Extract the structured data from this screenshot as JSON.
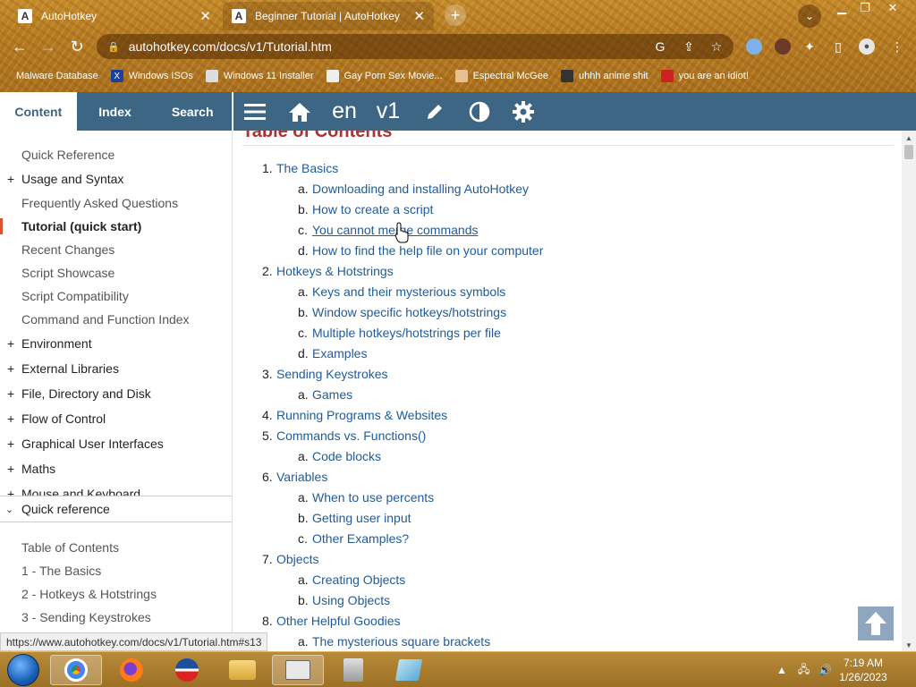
{
  "browser": {
    "tabs": [
      {
        "title": "AutoHotkey",
        "favicon": "A"
      },
      {
        "title": "Beginner Tutorial | AutoHotkey",
        "favicon": "A"
      }
    ],
    "url": "autohotkey.com/docs/v1/Tutorial.htm",
    "bookmarks": [
      {
        "label": "Malware Database"
      },
      {
        "label": "Windows ISOs"
      },
      {
        "label": "Windows 11 Installer"
      },
      {
        "label": "Gay Porn Sex Movie..."
      },
      {
        "label": "Espectral McGee"
      },
      {
        "label": "uhhh anime shit"
      },
      {
        "label": "you are an idiot!"
      }
    ],
    "status_url": "https://www.autohotkey.com/docs/v1/Tutorial.htm#s13"
  },
  "sidebar": {
    "tabs": {
      "content": "Content",
      "index": "Index",
      "search": "Search"
    },
    "items": [
      {
        "label": "Quick Reference"
      },
      {
        "label": "Usage and Syntax"
      },
      {
        "label": "Frequently Asked Questions"
      },
      {
        "label": "Tutorial (quick start)"
      },
      {
        "label": "Recent Changes"
      },
      {
        "label": "Script Showcase"
      },
      {
        "label": "Script Compatibility"
      },
      {
        "label": "Command and Function Index"
      },
      {
        "label": "Environment"
      },
      {
        "label": "External Libraries"
      },
      {
        "label": "File, Directory and Disk"
      },
      {
        "label": "Flow of Control"
      },
      {
        "label": "Graphical User Interfaces"
      },
      {
        "label": "Maths"
      },
      {
        "label": "Mouse and Keyboard"
      }
    ],
    "quick_ref_title": "Quick reference",
    "quick_ref_items": [
      {
        "label": "Table of Contents"
      },
      {
        "label": "1 - The Basics"
      },
      {
        "label": "2 - Hotkeys & Hotstrings"
      },
      {
        "label": "3 - Sending Keystrokes"
      }
    ]
  },
  "toolbar": {
    "lang": "en",
    "version": "v1"
  },
  "main": {
    "title": "Table of Contents",
    "sections": [
      {
        "num": "1.",
        "label": "The Basics",
        "subs": [
          {
            "let": "a.",
            "label": "Downloading and installing AutoHotkey"
          },
          {
            "let": "b.",
            "label": "How to create a script"
          },
          {
            "let": "c.",
            "label": "You cannot merge commands"
          },
          {
            "let": "d.",
            "label": "How to find the help file on your computer"
          }
        ]
      },
      {
        "num": "2.",
        "label": "Hotkeys & Hotstrings",
        "subs": [
          {
            "let": "a.",
            "label": "Keys and their mysterious symbols"
          },
          {
            "let": "b.",
            "label": "Window specific hotkeys/hotstrings"
          },
          {
            "let": "c.",
            "label": "Multiple hotkeys/hotstrings per file"
          },
          {
            "let": "d.",
            "label": "Examples"
          }
        ]
      },
      {
        "num": "3.",
        "label": "Sending Keystrokes",
        "subs": [
          {
            "let": "a.",
            "label": "Games"
          }
        ]
      },
      {
        "num": "4.",
        "label": "Running Programs & Websites",
        "subs": []
      },
      {
        "num": "5.",
        "label": "Commands vs. Functions()",
        "subs": [
          {
            "let": "a.",
            "label": "Code blocks"
          }
        ]
      },
      {
        "num": "6.",
        "label": "Variables",
        "subs": [
          {
            "let": "a.",
            "label": "When to use percents"
          },
          {
            "let": "b.",
            "label": "Getting user input"
          },
          {
            "let": "c.",
            "label": "Other Examples?"
          }
        ]
      },
      {
        "num": "7.",
        "label": "Objects",
        "subs": [
          {
            "let": "a.",
            "label": "Creating Objects"
          },
          {
            "let": "b.",
            "label": "Using Objects"
          }
        ]
      },
      {
        "num": "8.",
        "label": "Other Helpful Goodies",
        "subs": [
          {
            "let": "a.",
            "label": "The mysterious square brackets"
          }
        ]
      }
    ]
  },
  "taskbar": {
    "time": "7:19 AM",
    "date": "1/26/2023"
  },
  "colors": {
    "toolbar": "#3d6584",
    "link": "#1f5b99",
    "title": "#aa3333",
    "active_marker": "#d9532c"
  }
}
